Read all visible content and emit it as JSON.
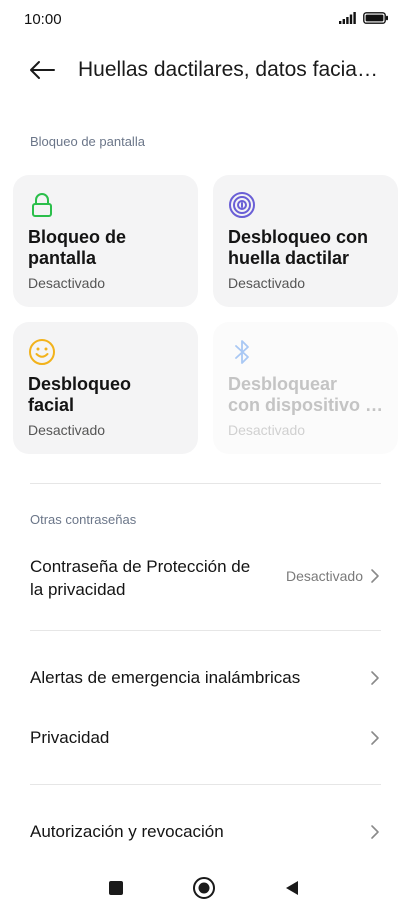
{
  "status_bar": {
    "time": "10:00"
  },
  "header": {
    "title": "Huellas dactilares, datos facia…"
  },
  "sections": {
    "screen_lock": "Bloqueo de pantalla",
    "other_passwords": "Otras contraseñas"
  },
  "tiles": [
    {
      "title": "Bloqueo de pantalla",
      "status": "Desactivado"
    },
    {
      "title": "Desbloqueo con huella dactilar",
      "status": "Desactivado"
    },
    {
      "title_line1": "Desbloqueo",
      "title_line2": "facial",
      "status": "Desactivado"
    },
    {
      "title_line1": "Desbloquear",
      "title_line2": "con dispositivo …",
      "status": "Desactivado"
    }
  ],
  "rows": [
    {
      "label_line1": "Contraseña de Protección de",
      "label_line2": "la privacidad",
      "value": "Desactivado"
    },
    {
      "label": "Alertas de emergencia inalámbricas"
    },
    {
      "label": "Privacidad"
    },
    {
      "label": "Autorización y revocación"
    }
  ],
  "colors": {
    "lock_icon": "#2bbf4b",
    "fingerprint_icon": "#6a5fd6",
    "face_icon": "#f2b21b",
    "bluetooth_icon": "#a9c8f4"
  }
}
